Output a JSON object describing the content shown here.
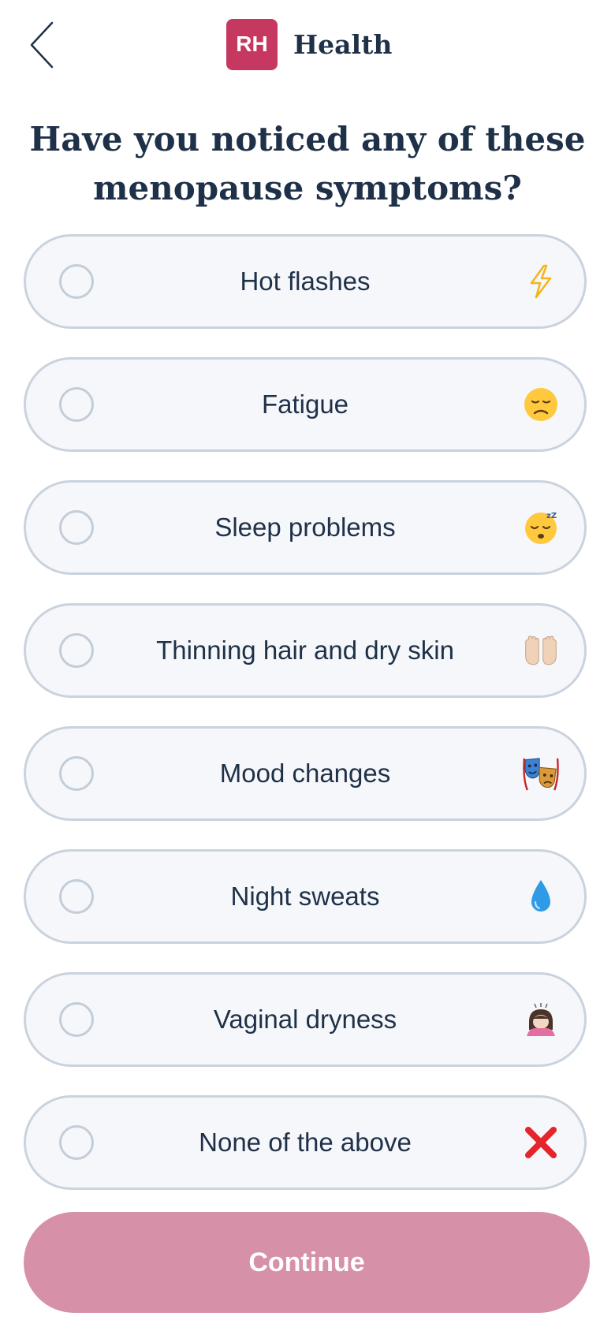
{
  "header": {
    "back_icon": "chevron-left-icon",
    "logo_text": "RH",
    "brand_name": "Health",
    "logo_color": "#c6385f"
  },
  "title": "Have you noticed any of these menopause symptoms?",
  "options": [
    {
      "label": "Hot flashes",
      "icon": "lightning-icon"
    },
    {
      "label": "Fatigue",
      "icon": "disappointed-face-icon"
    },
    {
      "label": "Sleep problems",
      "icon": "sleeping-face-icon"
    },
    {
      "label": "Thinning hair and dry skin",
      "icon": "raised-hands-icon"
    },
    {
      "label": "Mood changes",
      "icon": "performing-arts-icon"
    },
    {
      "label": "Night sweats",
      "icon": "droplet-icon"
    },
    {
      "label": "Vaginal dryness",
      "icon": "person-bowing-icon"
    },
    {
      "label": "None of the above",
      "icon": "cross-mark-icon"
    }
  ],
  "continue_label": "Continue",
  "colors": {
    "text": "#1f3148",
    "option_bg": "#f6f7fb",
    "option_border": "#c9d3de",
    "continue_bg": "#d691a8"
  }
}
